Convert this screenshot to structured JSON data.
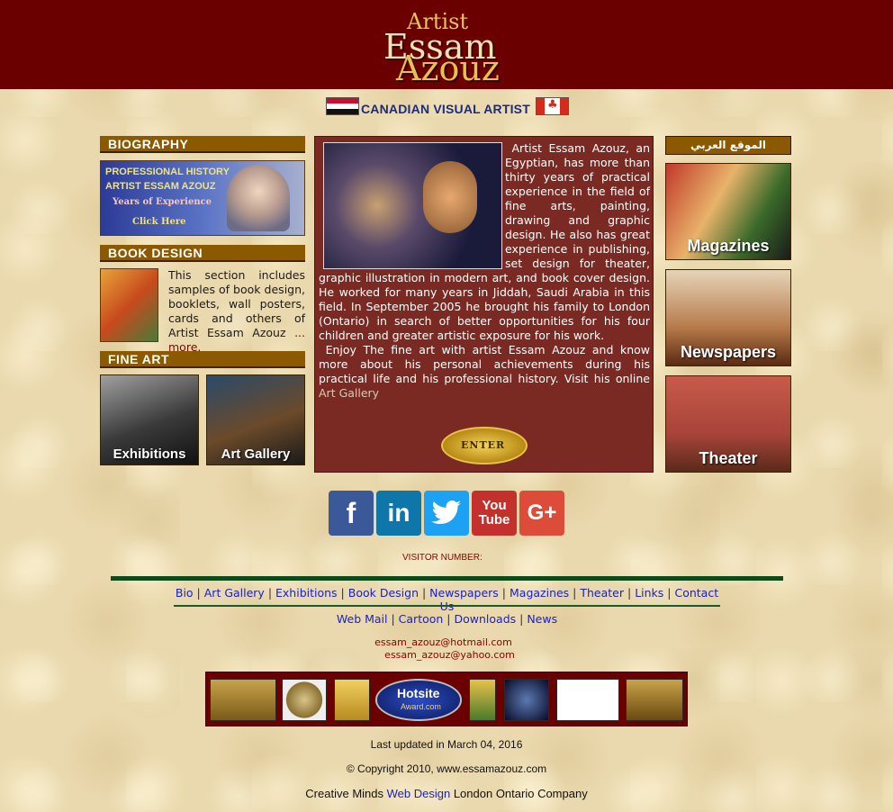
{
  "header": {
    "logo_artist": "Artist",
    "logo_first": "Essam",
    "logo_last": "Azouz",
    "tagline": "CANADIAN VISUAL ARTIST",
    "colors": {
      "header_bg": "#6b0000",
      "section_header": "#8b5a00",
      "link": "#1a22c4"
    }
  },
  "left": {
    "biography": {
      "heading": "BIOGRAPHY",
      "banner_line1": "PROFESSIONAL HISTORY",
      "banner_line2": "ARTIST ESSAM AZOUZ",
      "banner_line3": "Years of Experience",
      "banner_cta": "Click Here"
    },
    "book_design": {
      "heading": "BOOK DESIGN",
      "text": "This section includes samples of book design, booklets, wall posters, cards and others of Artist Essam Azouz",
      "more": "... more."
    },
    "fine_art": {
      "heading": "FINE ART",
      "tiles": [
        {
          "label": "Exhibitions"
        },
        {
          "label": "Art Gallery"
        }
      ]
    }
  },
  "center": {
    "paragraph1": "Artist Essam Azouz, an Egyptian, has more than thirty years of practical experience in the field of fine arts, painting, drawing and graphic design. He also has great experience in publishing, set design for theater, graphic illustration in modern art, and book cover design. He worked for many years in Jiddah, Saudi Arabia in this field. In September 2005 he brought his family to London (Ontario) in search of better opportunities for his four children and greater artistic exposure for his work.",
    "paragraph2": "Enjoy The fine art with artist Essam Azouz and know more about his personal achievements during his practical life and his professional history. Visit his online",
    "gallery_link": "Art Gallery",
    "enter_label": "ENTER"
  },
  "right": {
    "arabic_heading": "الموقع العربي",
    "tiles": [
      {
        "label": "Magazines"
      },
      {
        "label": "Newspapers"
      },
      {
        "label": "Theater"
      }
    ]
  },
  "social": {
    "icons": [
      "facebook-icon",
      "linkedin-icon",
      "twitter-icon",
      "youtube-icon",
      "google-plus-icon"
    ],
    "facebook_glyph": "f",
    "linkedin_glyph": "in",
    "youtube_glyph_1": "You",
    "youtube_glyph_2": "Tube",
    "google_glyph": "G+"
  },
  "visitor_label": "VISITOR NUMBER:",
  "nav_primary": [
    "Bio",
    "Art Gallery",
    "Exhibitions",
    "Book Design",
    "Newspapers",
    "Magazines",
    "Theater",
    "Links",
    "Contact Us"
  ],
  "nav_secondary": [
    "Web Mail",
    "Cartoon",
    "Downloads",
    "News"
  ],
  "contact": {
    "email1": "essam_azouz@hotmail.com",
    "email2": "essam_azouz@yahoo.com"
  },
  "awards": {
    "hotsite_label": "Hotsite",
    "hotsite_sub": "Award.com"
  },
  "footer": {
    "updated": "Last updated in March 04, 2016",
    "copyright": "© Copyright 2010, www.essamazouz.com",
    "credit_before": "Creative Minds",
    "credit_link": "Web Design",
    "credit_after": "London Ontario Company"
  }
}
